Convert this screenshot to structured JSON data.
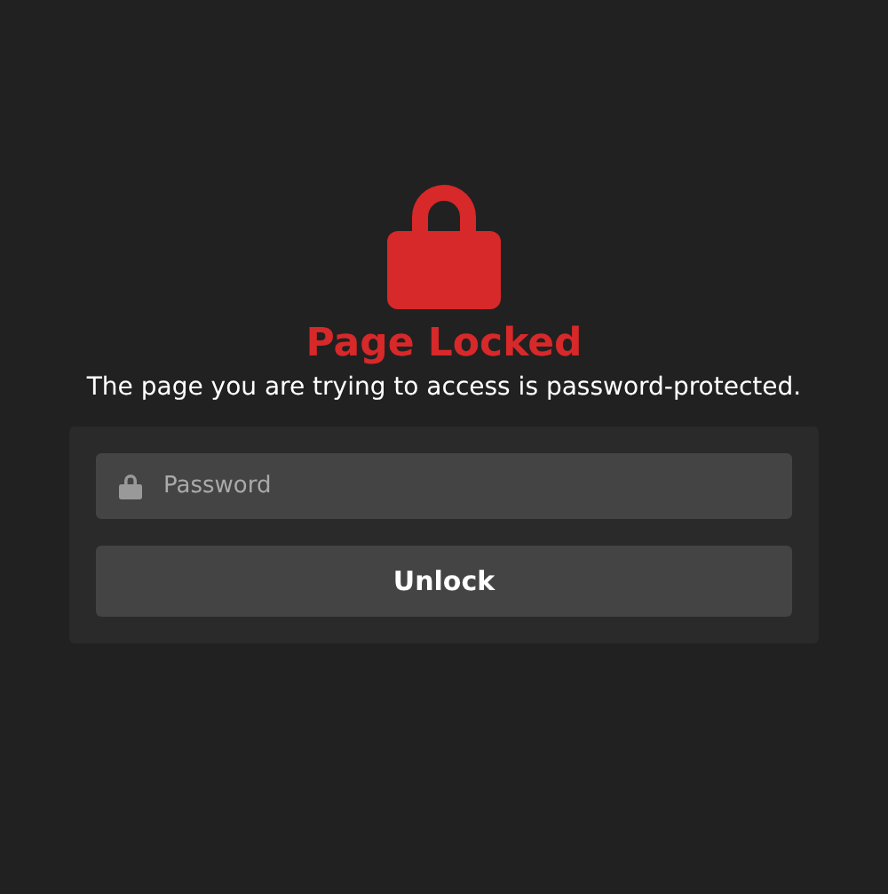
{
  "title": "Page Locked",
  "message": "The page you are trying to access is password-protected.",
  "password_field": {
    "placeholder": "Password"
  },
  "unlock_button": {
    "label": "Unlock"
  }
}
